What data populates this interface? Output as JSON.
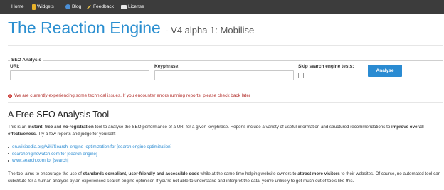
{
  "nav": {
    "items": [
      {
        "label": "Home",
        "icon": ""
      },
      {
        "label": "Widgets",
        "icon": "widgets-icon"
      },
      {
        "label": "Blog",
        "icon": "blog-globe-icon"
      },
      {
        "label": "Feedback",
        "icon": "feedback-pencil-icon"
      },
      {
        "label": "License",
        "icon": "license-card-icon"
      }
    ]
  },
  "header": {
    "title": "The Reaction Engine",
    "subtitle": "- V4 alpha 1: Mobilise"
  },
  "seo_form": {
    "legend": "SEO Analysis",
    "uri_label": "URI:",
    "uri_value": "",
    "keyphrase_label": "Keyphrase:",
    "keyphrase_value": "",
    "skip_label": "Skip search engine tests:",
    "skip_checked": false,
    "analyse_button": "Analyse"
  },
  "alert": {
    "text": "We are currently experiencing some technical issues. If you encounter errors running reports, please check back later"
  },
  "main": {
    "heading": "A Free SEO Analysis Tool",
    "intro": {
      "p1": "This is an ",
      "instant": "instant",
      "p2": ", ",
      "free": "free",
      "p3": " and ",
      "noreg": "no-registration",
      "p4": " tool to analyse the ",
      "seo_abbr": "SEO",
      "p5": " performance of a ",
      "uri_abbr": "URI",
      "p6": " for a given keyphrase. Reports include a variety of useful information and structured recommendations to ",
      "improve": "improve overall effectiveness",
      "p7": ". Try a few reports and judge for yourself:"
    },
    "links": [
      "en.wikipedia.org/wiki/Search_engine_optimization for [search engine optimization]",
      "searchenginewatch.com for [search engine]",
      "www.search.com for [search]"
    ],
    "aim": {
      "p1": "The tool aims to encourage the use of ",
      "standards": "standards compliant, user-friendly and accessible code",
      "p2": " while at the same time helping website-owners to ",
      "attract": "attract more visitors",
      "p3": " to their websites. Of course, no automated tool can substitute for a human analysis by an experienced search engine optimiser. If you're not able to understand and interpret the data, you're unlikely to get much out of tools like this."
    }
  },
  "colors": {
    "navbar_bg": "#3c3c3c",
    "title_blue": "#2b8fd0",
    "button_blue": "#2a8bd2",
    "link_blue": "#2a8bd2",
    "alert_red": "#b3302c"
  }
}
